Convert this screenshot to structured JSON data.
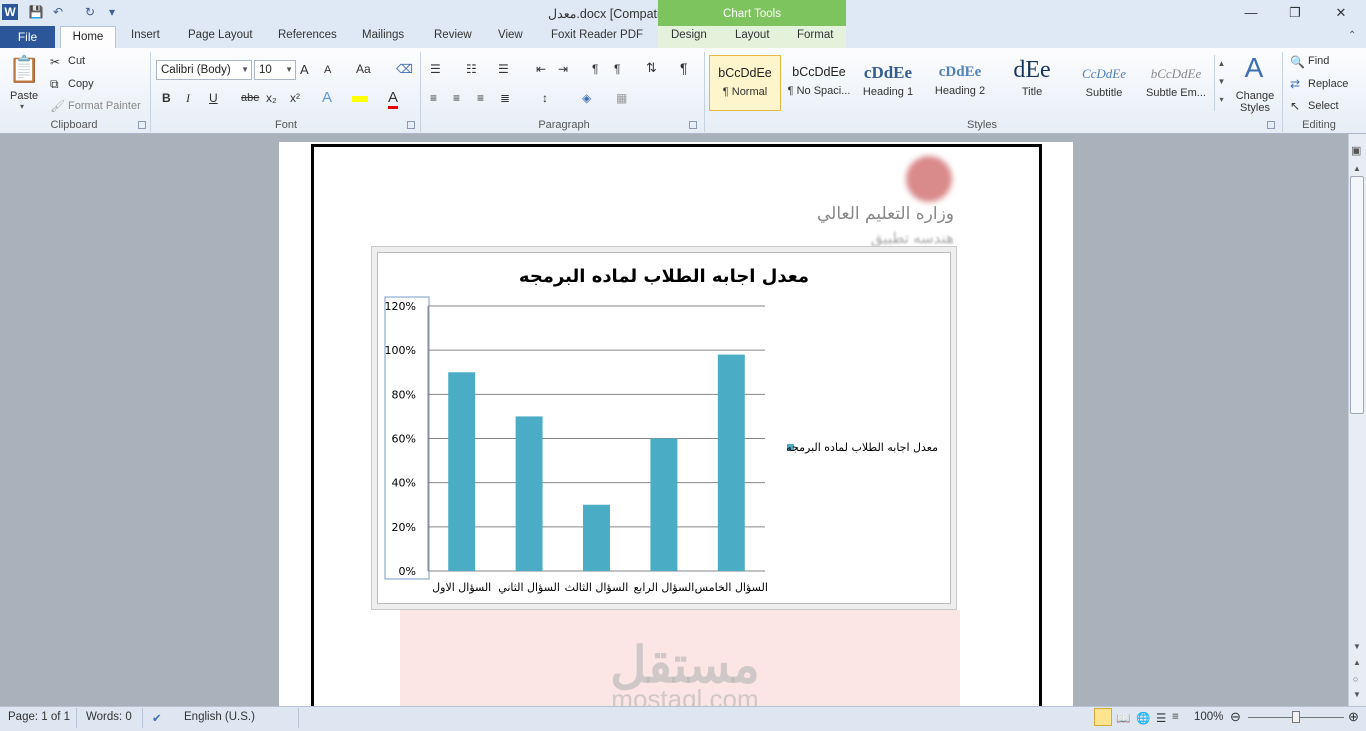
{
  "window": {
    "title": "معدل.docx [Compatibility Mode]  -  Microsoft Word",
    "contextual_header": "Chart Tools"
  },
  "tabs": {
    "file": "File",
    "home": "Home",
    "insert": "Insert",
    "page_layout": "Page Layout",
    "references": "References",
    "mailings": "Mailings",
    "review": "Review",
    "view": "View",
    "foxit": "Foxit Reader PDF",
    "design": "Design",
    "layout": "Layout",
    "format": "Format"
  },
  "clipboard": {
    "paste": "Paste",
    "cut": "Cut",
    "copy": "Copy",
    "format_painter": "Format Painter",
    "label": "Clipboard"
  },
  "font": {
    "name": "Calibri (Body)",
    "size": "10",
    "label": "Font",
    "bold": "B",
    "italic": "I",
    "underline": "U",
    "strike": "abe",
    "sub": "x₂",
    "sup": "x²",
    "grow": "A",
    "shrink": "A",
    "case": "Aa"
  },
  "paragraph": {
    "label": "Paragraph"
  },
  "styles": {
    "label": "Styles",
    "items": [
      {
        "preview": "bCcDdEe",
        "name": "¶ Normal"
      },
      {
        "preview": "bCcDdEe",
        "name": "¶ No Spaci..."
      },
      {
        "preview": "cDdEe",
        "name": "Heading 1"
      },
      {
        "preview": "cDdEe",
        "name": "Heading 2"
      },
      {
        "preview": "dEe",
        "name": "Title"
      },
      {
        "preview": "CcDdEe",
        "name": "Subtitle"
      },
      {
        "preview": "bCcDdEe",
        "name": "Subtle Em..."
      }
    ],
    "change_styles": "Change Styles"
  },
  "editing": {
    "label": "Editing",
    "find": "Find",
    "replace": "Replace",
    "select": "Select"
  },
  "document": {
    "ministry": "وزاره التعليم العالي",
    "department": "هندسه تطبيق",
    "watermark": "مستقل",
    "watermark_url": "mostaql.com"
  },
  "chart_data": {
    "type": "bar",
    "title": "معدل اجابه الطلاب لماده البرمجه",
    "categories": [
      "السؤال الاول",
      "السؤال الثاني",
      "السؤال الثالث",
      "السؤال الرابع",
      "السؤال الخامس"
    ],
    "series": [
      {
        "name": "معدل اجابه الطلاب لماده البرمجه",
        "values": [
          0.9,
          0.7,
          0.3,
          0.6,
          0.98
        ],
        "color": "#4bacc6"
      }
    ],
    "yticks": [
      "0%",
      "20%",
      "40%",
      "60%",
      "80%",
      "100%",
      "120%"
    ],
    "ylim": [
      0,
      1.2
    ],
    "grid": true,
    "legend": "right"
  },
  "status": {
    "page": "Page: 1 of 1",
    "words": "Words: 0",
    "language": "English (U.S.)",
    "zoom": "100%"
  }
}
